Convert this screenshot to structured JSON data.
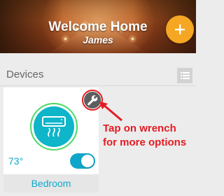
{
  "header": {
    "title": "Welcome Home",
    "username": "James",
    "add_icon": "plus-icon",
    "colors": {
      "accent": "#f5a623"
    }
  },
  "devices_section": {
    "title": "Devices",
    "menu_icon": "list-icon"
  },
  "devices": [
    {
      "room": "Bedroom",
      "temperature": "73°",
      "device_icon": "air-conditioner-icon",
      "settings_icon": "wrench-icon",
      "power_on": true,
      "colors": {
        "device": "#0fb5c9",
        "ring": "#4cd964",
        "text": "#0fa7c9"
      }
    }
  ],
  "annotation": {
    "line1": "Tap on wrench",
    "line2": "for more options",
    "color": "#e31b23"
  }
}
